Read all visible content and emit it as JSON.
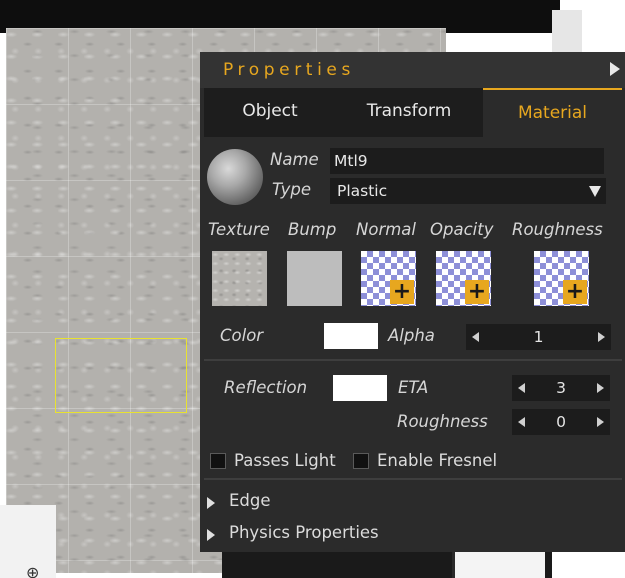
{
  "panel": {
    "title": "Properties",
    "tabs": [
      "Object",
      "Transform",
      "Material"
    ],
    "active_tab": "Material"
  },
  "material": {
    "name_label": "Name",
    "name_value": "Mtl9",
    "type_label": "Type",
    "type_value": "Plastic",
    "slots": [
      "Texture",
      "Bump",
      "Normal",
      "Opacity",
      "Roughness"
    ],
    "color_label": "Color",
    "color_value": "#ffffff",
    "alpha_label": "Alpha",
    "alpha_value": "1",
    "reflection_label": "Reflection",
    "reflection_color": "#ffffff",
    "eta_label": "ETA",
    "eta_value": "3",
    "roughness_label": "Roughness",
    "roughness_value": "0",
    "passes_light_label": "Passes Light",
    "passes_light_checked": false,
    "enable_fresnel_label": "Enable Fresnel",
    "enable_fresnel_checked": false
  },
  "sections": [
    "Edge",
    "Physics Properties"
  ],
  "colors": {
    "accent": "#e7a71f",
    "panel_bg": "#2b2b2b",
    "field_bg": "#1c1c1c",
    "selection": "#e8e230"
  }
}
